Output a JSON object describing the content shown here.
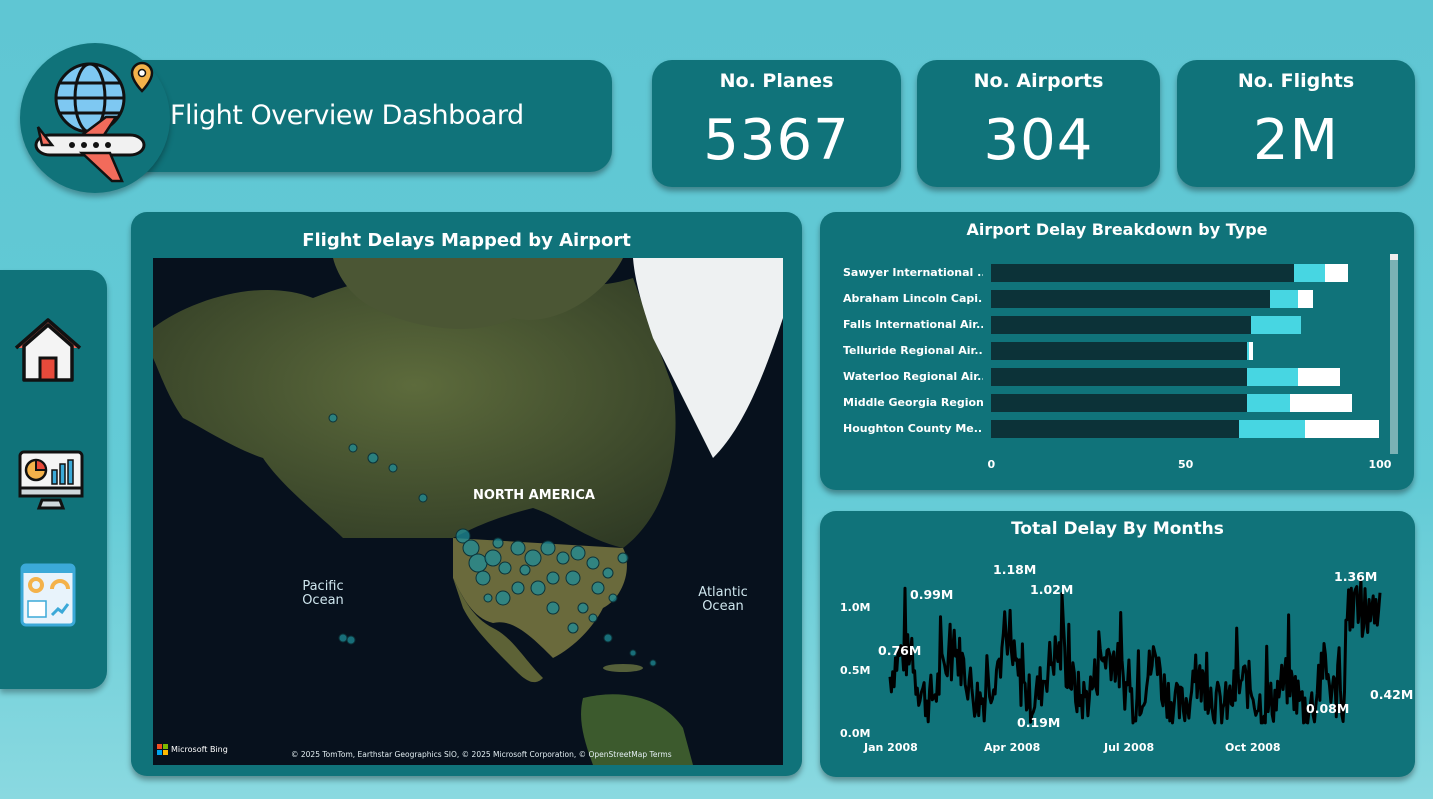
{
  "header": {
    "title": "Flight Overview Dashboard"
  },
  "kpis": [
    {
      "label": "No. Planes",
      "value": "5367"
    },
    {
      "label": "No. Airports",
      "value": "304"
    },
    {
      "label": "No. Flights",
      "value": "2M"
    }
  ],
  "nav": {
    "items": [
      {
        "name": "home-icon"
      },
      {
        "name": "analytics-monitor-icon"
      },
      {
        "name": "dashboard-icon"
      }
    ]
  },
  "map": {
    "title": "Flight Delays Mapped by Airport",
    "labels": {
      "continent": "NORTH AMERICA",
      "pacific": "Pacific\nOcean",
      "atlantic": "Atlantic\nOcean"
    },
    "provider": "Microsoft Bing",
    "attribution": "© 2025 TomTom, Earthstar Geographics SIO, © 2025 Microsoft Corporation, © OpenStreetMap Terms"
  },
  "bar_chart": {
    "title": "Airport Delay Breakdown by Type"
  },
  "line_chart": {
    "title": "Total Delay By Months"
  },
  "chart_data": [
    {
      "type": "bar",
      "orientation": "horizontal",
      "stacked": true,
      "title": "Airport Delay Breakdown by Type",
      "categories": [
        "Sawyer International ...",
        "Abraham Lincoln Capi...",
        "Falls International Air...",
        "Telluride Regional Air...",
        "Waterloo Regional Air...",
        "Middle Georgia Region...",
        "Houghton County Me..."
      ],
      "series": [
        {
          "color": "#0c3238",
          "values": [
            78,
            72,
            67,
            66,
            66,
            66,
            64
          ]
        },
        {
          "color": "#47d6e2",
          "values": [
            8,
            7,
            13,
            0.5,
            13,
            11,
            17
          ]
        },
        {
          "color": "#ffffff",
          "values": [
            6,
            4,
            0,
            1,
            11,
            16,
            19
          ]
        }
      ],
      "xlim": [
        0,
        100
      ],
      "xticks": [
        "0",
        "50",
        "100"
      ]
    },
    {
      "type": "line",
      "title": "Total Delay By Months",
      "x": [
        "Jan 2008",
        "Apr 2008",
        "Jul 2008",
        "Oct 2008"
      ],
      "yticks": [
        "0.0M",
        "0.5M",
        "1.0M"
      ],
      "ylim": [
        0,
        1.0
      ],
      "color": "#000000",
      "annotations": [
        "0.76M",
        "0.99M",
        "1.18M",
        "1.02M",
        "0.19M",
        "0.08M",
        "1.36M",
        "0.42M"
      ]
    }
  ]
}
